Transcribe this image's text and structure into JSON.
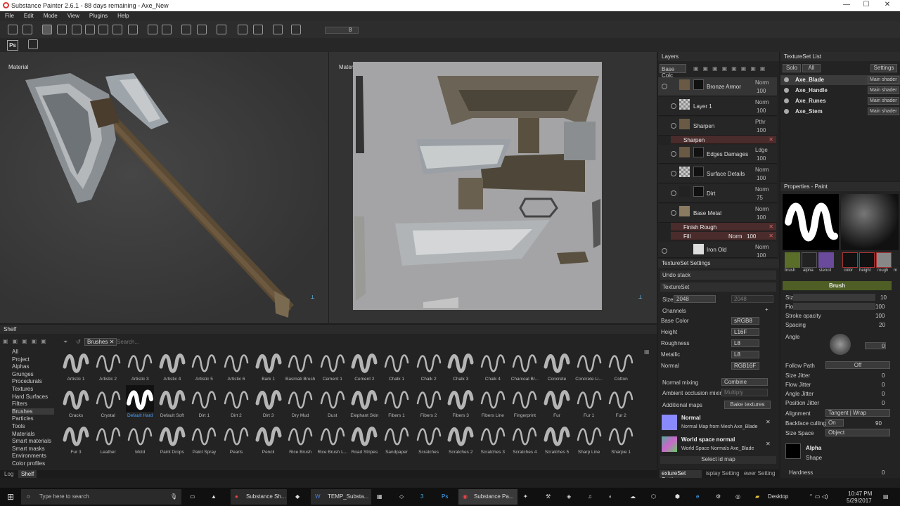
{
  "window": {
    "title": "Substance Painter 2.6.1 - 88 days remaining - Axe_New",
    "min": "—",
    "max": "☐",
    "close": "✕"
  },
  "menu": [
    "File",
    "Edit",
    "Mode",
    "View",
    "Plugins",
    "Help"
  ],
  "toolbar": {
    "value": "8",
    "ps": "Ps"
  },
  "viewport3d": {
    "label": "Material"
  },
  "viewport2d": {
    "label": "Material"
  },
  "layers": {
    "title": "Layers",
    "channel": "Base Colc",
    "items": [
      {
        "name": "Bronze Armor",
        "blend": "Norm",
        "opacity": "100"
      },
      {
        "name": "Layer 1",
        "blend": "Norm",
        "opacity": "100"
      },
      {
        "name": "Sharpen",
        "blend": "Pthr",
        "opacity": "100"
      },
      {
        "name": "Edges Damages",
        "blend": "Ldge",
        "opacity": "100"
      },
      {
        "name": "Surface Details",
        "blend": "Norm",
        "opacity": "100"
      },
      {
        "name": "Dirt",
        "blend": "Norm",
        "opacity": "75"
      },
      {
        "name": "Base Metal",
        "blend": "Norm",
        "opacity": "100"
      },
      {
        "name": "Iron Old",
        "blend": "Norm",
        "opacity": "100"
      }
    ],
    "fx_sharpen": "Sharpen",
    "fx_finish": "Finish Rough",
    "fx_fill": "Fill",
    "fx_fill_blend": "Norm",
    "fx_fill_opacity": "100"
  },
  "textureset_list": {
    "title": "TextureSet List",
    "solo": "Solo",
    "all": "All",
    "settings": "Settings",
    "items": [
      {
        "name": "Axe_Blade",
        "shader": "Main shader"
      },
      {
        "name": "Axe_Handle",
        "shader": "Main shader"
      },
      {
        "name": "Axe_Runes",
        "shader": "Main shader"
      },
      {
        "name": "Axe_Stem",
        "shader": "Main shader"
      }
    ]
  },
  "ts_settings": {
    "title": "TextureSet Settings",
    "undo": "Undo stack",
    "textureset": "TextureSet",
    "size_label": "Size",
    "size": "2048",
    "size2": "2048",
    "channels": "Channels",
    "channel_rows": [
      {
        "name": "Base Color",
        "fmt": "sRGB8"
      },
      {
        "name": "Height",
        "fmt": "L16F"
      },
      {
        "name": "Roughness",
        "fmt": "L8"
      },
      {
        "name": "Metallic",
        "fmt": "L8"
      },
      {
        "name": "Normal",
        "fmt": "RGB16F"
      }
    ],
    "normal_mixing": "Normal mixing",
    "normal_mixing_val": "Combine",
    "ao_mixing": "Ambient occlusion mixing",
    "ao_mixing_val": "Multiply",
    "additional_maps": "Additional maps",
    "bake": "Bake textures",
    "map1_title": "Normal",
    "map1_sub": "Normal Map from Mesh Axe_Blade",
    "map2_title": "World space normal",
    "map2_sub": "World Space Normals Axe_Blade",
    "select_id": "Select id map",
    "tabs": [
      "extureSet Setting",
      "isplay Setting",
      "ewer Setting"
    ]
  },
  "properties": {
    "title": "Properties - Paint",
    "chips": [
      "brush",
      "alpha",
      "stencil",
      "color",
      "height",
      "rough",
      "m"
    ],
    "brush": "Brush",
    "size_label": "Size",
    "size": "10",
    "flow_label": "Flow",
    "flow": "100",
    "stroke_label": "Stroke opacity",
    "stroke": "100",
    "spacing_label": "Spacing",
    "spacing": "20",
    "angle_label": "Angle",
    "angle": "0",
    "follow_label": "Follow Path",
    "follow": "Off",
    "jitters": [
      {
        "label": "Size Jitter",
        "val": "0"
      },
      {
        "label": "Flow Jitter",
        "val": "0"
      },
      {
        "label": "Angle Jitter",
        "val": "0"
      },
      {
        "label": "Position Jitter",
        "val": "0"
      }
    ],
    "alignment_label": "Alignment",
    "alignment": "Tangent | Wrap",
    "backface_label": "Backface culling",
    "backface": "On",
    "backface_val": "90",
    "sizespace_label": "Size Space",
    "sizespace": "Object",
    "alpha_title": "Alpha",
    "alpha_sub": "Shape",
    "hardness": "Hardness",
    "hardness_val": "0"
  },
  "shelf": {
    "title": "Shelf",
    "tag": "Brushes",
    "search": "Search...",
    "categories": [
      "All",
      "Project",
      "Alphas",
      "Grunges",
      "Procedurals",
      "Textures",
      "Hard Surfaces",
      "Filters",
      "Brushes",
      "Particles",
      "Tools",
      "Materials",
      "Smart materials",
      "Smart masks",
      "Environments",
      "Color profiles"
    ],
    "brushes": [
      "Artistic 1",
      "Artistic 2",
      "Artistic 3",
      "Artistic 4",
      "Artistic 5",
      "Artistic 6",
      "Bark 1",
      "Basmati Brush",
      "Cement 1",
      "Cement 2",
      "Chalk 1",
      "Chalk 2",
      "Chalk 3",
      "Chalk 4",
      "Charcoal Br...",
      "Concrete",
      "Concrete Li...",
      "Cotton",
      "Cracks",
      "Crystal",
      "Default Hard",
      "Default Soft",
      "Dirt 1",
      "Dirt 2",
      "Dirt 3",
      "Dry Mud",
      "Dust",
      "Elephant Skin",
      "Fibers 1",
      "Fibers 2",
      "Fibers 3",
      "Fibers Line",
      "Fingerprint",
      "Fur",
      "Fur 1",
      "Fur 2",
      "Fur 3",
      "Leather",
      "Mold",
      "Paint Drops",
      "Paint Spray",
      "Pearls",
      "Pencil",
      "Rice Brush",
      "Rice Brush L...",
      "Road Stripes",
      "Sandpaper",
      "Scratches",
      "Scratches 2",
      "Scratches 3",
      "Scratches 4",
      "Scratches 5",
      "Sharp Line",
      "Sharpie 1"
    ],
    "selected": "Default Hard",
    "bottom_tabs": [
      "Log",
      "Shelf"
    ]
  },
  "taskbar": {
    "search": "Type here to search",
    "apps": [
      "Substance Sh...",
      "TEMP_Substa...",
      "Substance Pa..."
    ],
    "desktop": "Desktop",
    "time": "10:47 PM",
    "date": "5/29/2017"
  },
  "colors": {
    "accent": "#6b8e23",
    "selected_text": "#4aa3ff",
    "fx_bg": "#4a2c2c"
  }
}
